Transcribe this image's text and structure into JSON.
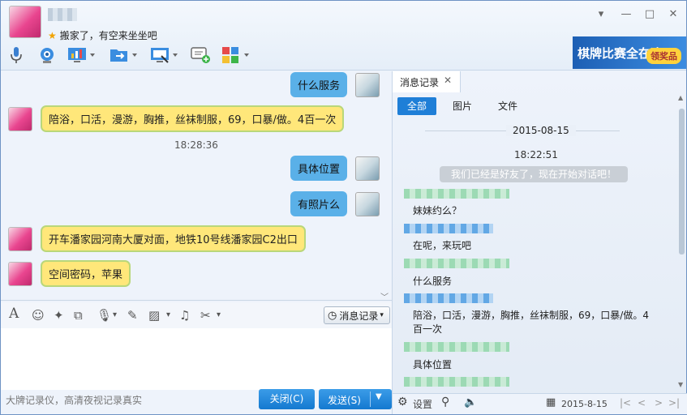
{
  "header": {
    "signature": "搬家了，有空来坐坐吧",
    "minimize_glyph": "▾",
    "restore_glyph": "—",
    "maximize_glyph": "□",
    "close_glyph": "✕"
  },
  "toolbar_icons": [
    "microphone-icon",
    "video-call-icon",
    "screen-share-icon",
    "file-transfer-icon",
    "remote-desktop-icon",
    "message-add-icon",
    "apps-icon"
  ],
  "ad": {
    "title": "棋牌比赛全在这!",
    "button": "领奖品"
  },
  "chat": {
    "messages": [
      {
        "side": "me",
        "text": "什么服务"
      },
      {
        "side": "her",
        "text": "陪浴，口活，漫游，胸推，丝袜制服，69，口暴/做。4百一次"
      },
      {
        "side": "time",
        "text": "18:28:36"
      },
      {
        "side": "me",
        "text": "具体位置"
      },
      {
        "side": "me",
        "text": "有照片么"
      },
      {
        "side": "her",
        "text": "开车潘家园河南大厦对面，地铁10号线潘家园C2出口"
      },
      {
        "side": "her",
        "text": "空间密码，苹果"
      }
    ]
  },
  "format_toolbar": {
    "history_button": "消息记录"
  },
  "footer": {
    "tip": "大牌记录仪，高清夜视记录真实",
    "close_button": "关闭(C)",
    "send_button": "发送(S)"
  },
  "history": {
    "tab_label": "消息记录",
    "filters": [
      "全部",
      "图片",
      "文件"
    ],
    "date": "2015-08-15",
    "first_time": "18:22:51",
    "system_message": "我们已经是好友了，现在开始对话吧！",
    "messages": [
      "妹妹约么？",
      "在呢，来玩吧",
      "什么服务",
      "陪浴，口活，漫游，胸推，丝袜制服，69，口暴/做。4百一次",
      "具体位置"
    ],
    "settings_label": "设置",
    "footer_date": "2015-8-15"
  },
  "colors": {
    "accent": "#1f7fd7",
    "my_bubble": "#5ab0e8",
    "her_bubble": "#ffe77a",
    "her_bubble_border": "#b9d77a"
  }
}
